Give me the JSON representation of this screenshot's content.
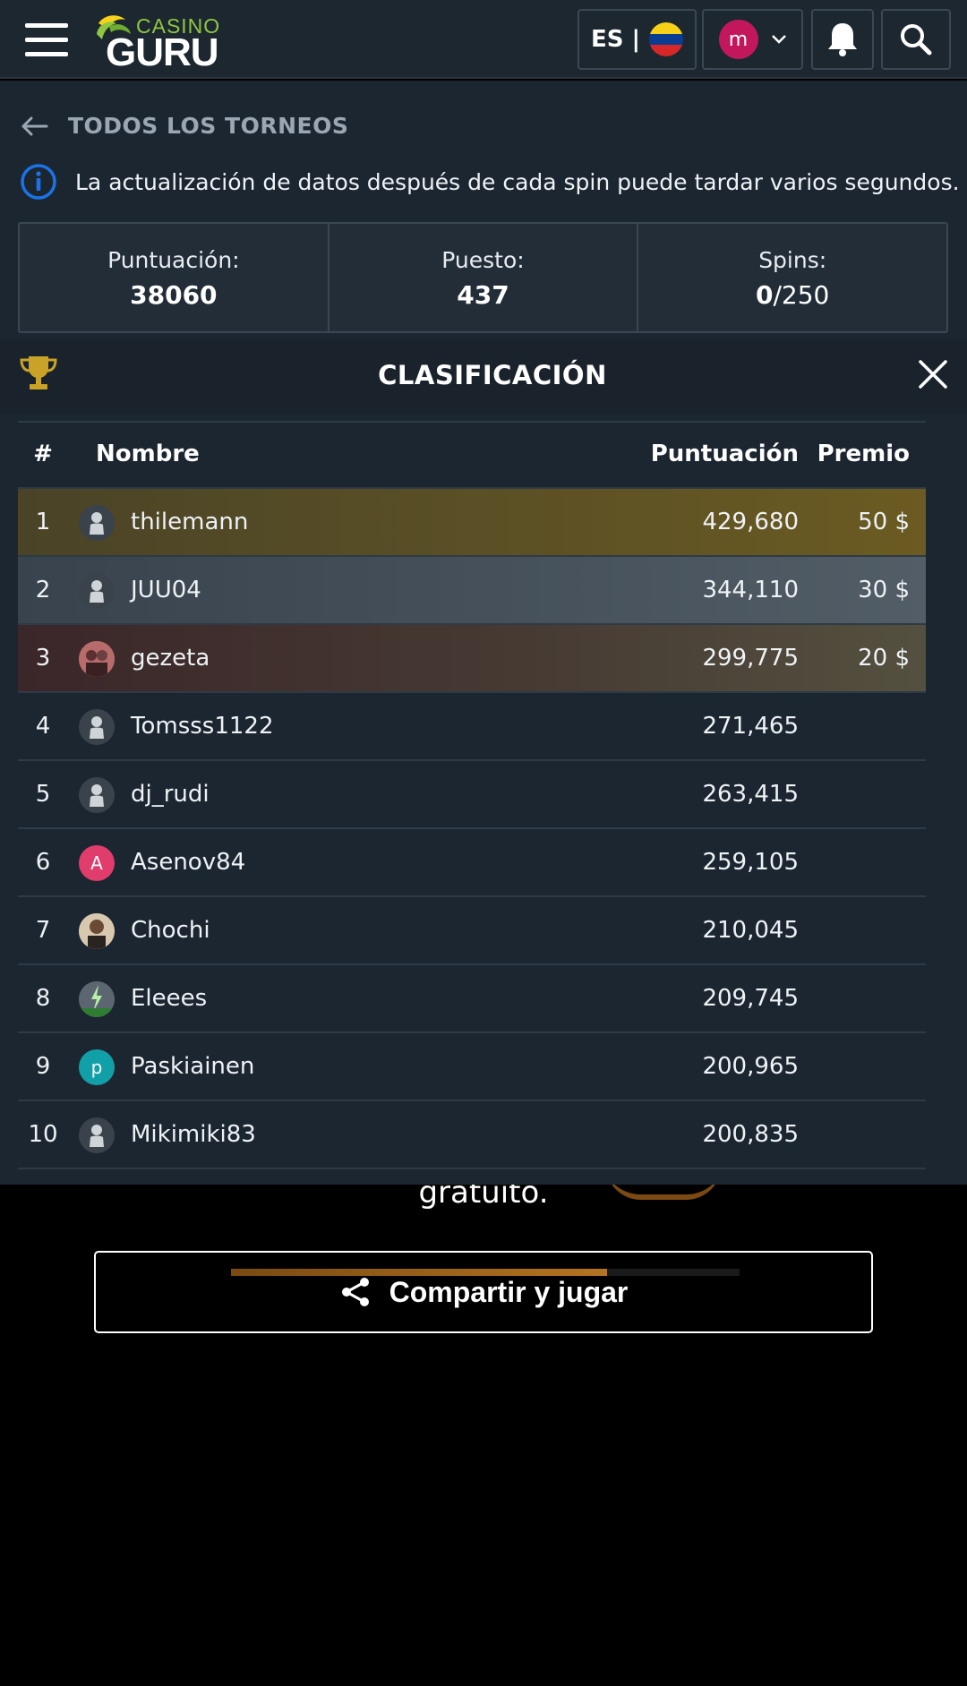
{
  "header": {
    "logo_top": "CASINO",
    "logo_bottom": "GURU",
    "language": "ES |",
    "user_initial": "m",
    "icons": [
      "menu-icon",
      "flag-icon",
      "chevron-down-icon",
      "bell-icon",
      "search-icon"
    ]
  },
  "nav": {
    "back_label": "TODOS LOS TORNEOS"
  },
  "info": {
    "text": "La actualización de datos después de cada spin puede tardar varios segundos."
  },
  "stats": {
    "score_label": "Puntuación:",
    "score_value": "38060",
    "rank_label": "Puesto:",
    "rank_value": "437",
    "spins_label": "Spins:",
    "spins_used": "0",
    "spins_total": "/250"
  },
  "leaderboard": {
    "title": "CLASIFICACIÓN",
    "columns": {
      "rank": "#",
      "name": "Nombre",
      "score": "Puntuación",
      "prize": "Premio"
    },
    "rows": [
      {
        "rank": "1",
        "name": "thilemann",
        "score": "429,680",
        "prize": "50 $"
      },
      {
        "rank": "2",
        "name": "JUU04",
        "score": "344,110",
        "prize": "30 $"
      },
      {
        "rank": "3",
        "name": "gezeta",
        "score": "299,775",
        "prize": "20 $"
      },
      {
        "rank": "4",
        "name": "Tomsss1122",
        "score": "271,465",
        "prize": ""
      },
      {
        "rank": "5",
        "name": "dj_rudi",
        "score": "263,415",
        "prize": ""
      },
      {
        "rank": "6",
        "name": "Asenov84",
        "score": "259,105",
        "prize": "",
        "avatar_letter": "A"
      },
      {
        "rank": "7",
        "name": "Chochi",
        "score": "210,045",
        "prize": ""
      },
      {
        "rank": "8",
        "name": "Eleees",
        "score": "209,745",
        "prize": ""
      },
      {
        "rank": "9",
        "name": "Paskiainen",
        "score": "200,965",
        "prize": "",
        "avatar_letter": "p"
      },
      {
        "rank": "10",
        "name": "Mikimiki83",
        "score": "200,835",
        "prize": ""
      }
    ]
  },
  "background": {
    "gratuito": "gratuito.",
    "share_label": "Compartir y jugar",
    "progress": 0.74
  },
  "colors": {
    "gold_row": "#5a4f25",
    "silver_row": "#47525c",
    "bronze_row": "#463a33",
    "accent_blue": "#1a73e8",
    "trophy": "#c9a227"
  }
}
